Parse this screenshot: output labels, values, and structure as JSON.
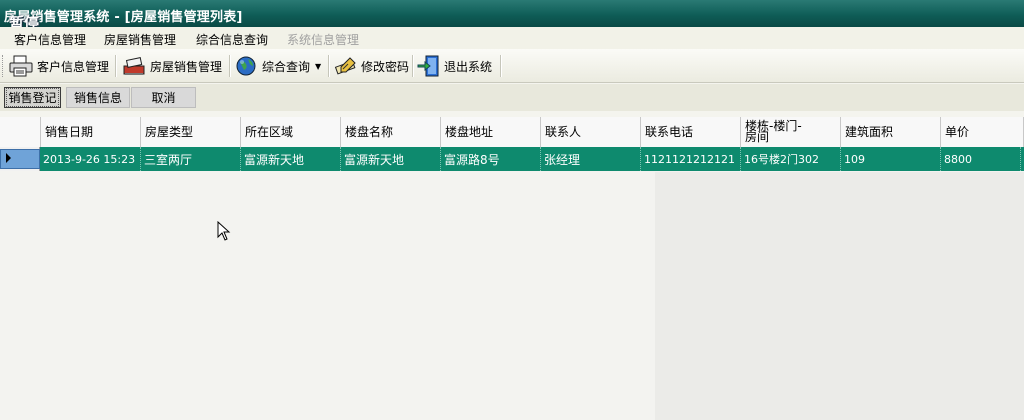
{
  "window": {
    "title": "房屋销售管理系统 - [房屋销售管理列表]",
    "overlay_text": "暂停"
  },
  "menu": {
    "items": [
      {
        "label": "客户信息管理",
        "enabled": true
      },
      {
        "label": "房屋销售管理",
        "enabled": true
      },
      {
        "label": "综合信息查询",
        "enabled": true
      },
      {
        "label": "系统信息管理",
        "enabled": false
      }
    ]
  },
  "toolbar": {
    "customer_label": "客户信息管理",
    "sales_label": "房屋销售管理",
    "query_label": "综合查询",
    "password_label": "修改密码",
    "exit_label": "退出系统"
  },
  "actions": {
    "register_label": "销售登记",
    "info_label": "销售信息",
    "cancel_label": "取消"
  },
  "grid": {
    "columns": [
      "销售日期",
      "房屋类型",
      "所在区域",
      "楼盘名称",
      "楼盘地址",
      "联系人",
      "联系电话",
      "楼栋-楼门-房间",
      "建筑面积",
      "单价"
    ],
    "rows": [
      [
        "2013-9-26 15:23",
        "三室两厅",
        "富源新天地",
        "富源新天地",
        "富源路8号",
        "张经理",
        "1121121212121",
        "16号楼2门302",
        "109",
        "8800"
      ]
    ]
  },
  "colors": {
    "titlebar": "#0f5d57",
    "selected_row": "#0e8a6e"
  }
}
